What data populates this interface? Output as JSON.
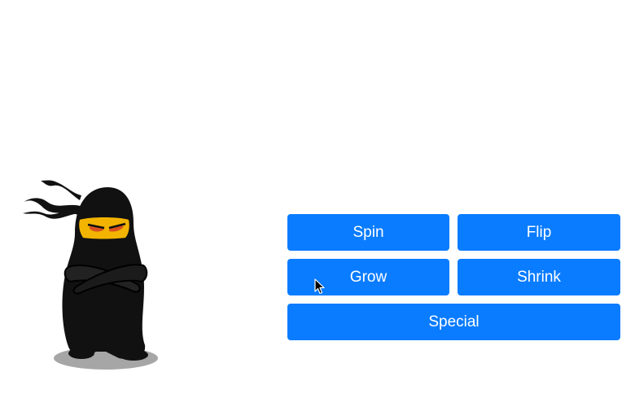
{
  "character": {
    "icon": "ninja-icon",
    "colors": {
      "body": "#111111",
      "mask": "#f2b400",
      "eyes": "#d9501e"
    }
  },
  "controls": {
    "spin_label": "Spin",
    "flip_label": "Flip",
    "grow_label": "Grow",
    "shrink_label": "Shrink",
    "special_label": "Special",
    "button_color": "#0a7cff",
    "text_color": "#ffffff"
  },
  "pointer": {
    "icon": "mouse-pointer-icon"
  }
}
